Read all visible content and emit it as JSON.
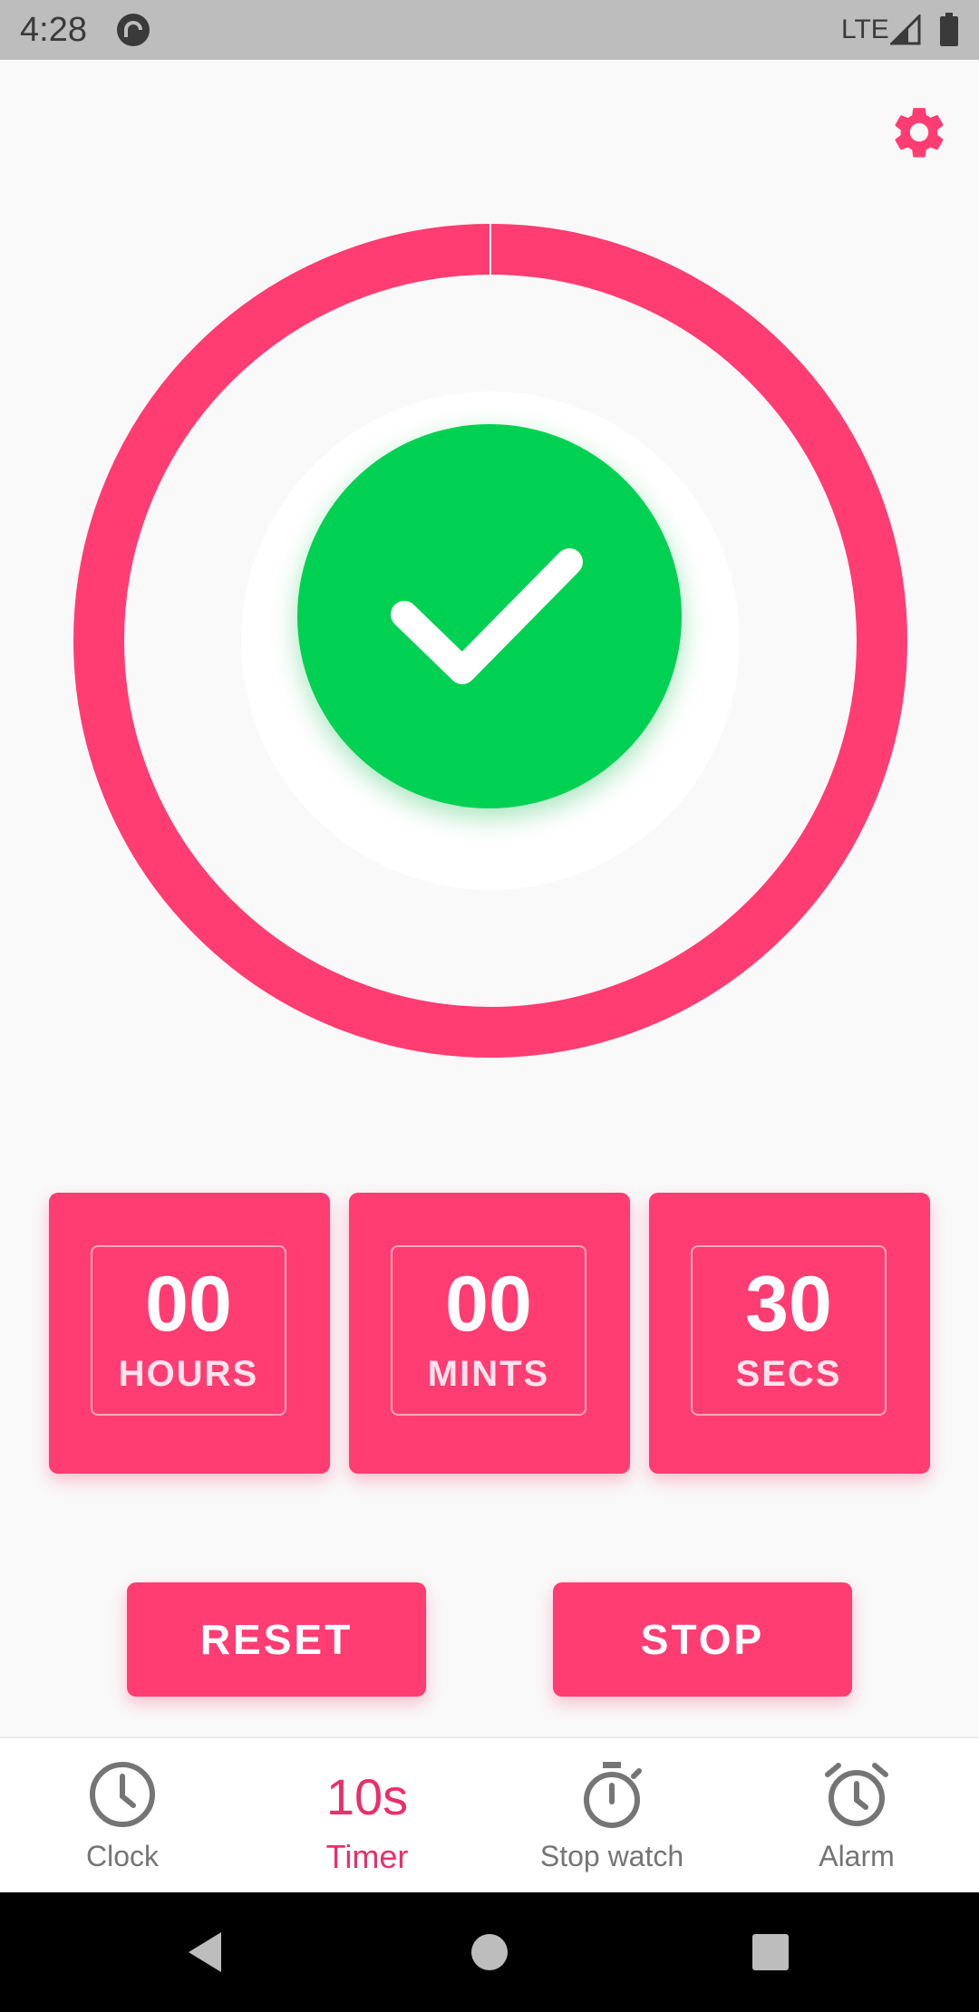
{
  "status_bar": {
    "time": "4:28",
    "network": "LTE",
    "app_icon": "pocket-casts-icon",
    "signal_icon": "signal-icon",
    "battery_icon": "battery-icon"
  },
  "settings": {
    "icon": "gear-icon"
  },
  "timer_ring": {
    "progress": 1.0,
    "color": "#ff3d72"
  },
  "center_button": {
    "icon": "check-icon",
    "color": "#00d152"
  },
  "time": {
    "hours": {
      "value": "00",
      "label": "HOURS"
    },
    "minutes": {
      "value": "00",
      "label": "MINTS"
    },
    "seconds": {
      "value": "30",
      "label": "SECS"
    }
  },
  "actions": {
    "reset": "RESET",
    "stop": "STOP"
  },
  "bottom_nav": {
    "items": [
      {
        "label": "Clock",
        "icon": "clock-icon",
        "active": false
      },
      {
        "label": "Timer",
        "value": "10s",
        "active": true
      },
      {
        "label": "Stop watch",
        "icon": "stopwatch-icon",
        "active": false
      },
      {
        "label": "Alarm",
        "icon": "alarm-icon",
        "active": false
      }
    ]
  },
  "system_nav": {
    "back": "back-icon",
    "home": "home-icon",
    "recents": "recents-icon"
  },
  "colors": {
    "accent": "#ff3d72",
    "success": "#00d152",
    "nav_inactive": "#757575"
  }
}
